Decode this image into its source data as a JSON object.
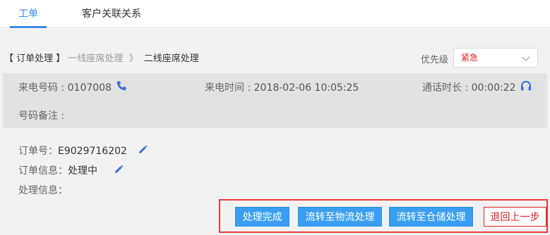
{
  "tabs": [
    {
      "label": "工单",
      "active": true
    },
    {
      "label": "客户关联关系",
      "active": false
    }
  ],
  "breadcrumb": {
    "current": "【 订单处理 】",
    "step1": "一线座席处理",
    "separator": "》",
    "step2": "二线座席处理"
  },
  "priority": {
    "label": "优先级",
    "value": "紧急"
  },
  "call_info": {
    "number_label": "来电号码 : ",
    "number_value": "0107008",
    "time_label": "来电时间 : ",
    "time_value": "2018-02-06 10:05:25",
    "duration_label": "通话时长 : ",
    "duration_value": "00:00:22",
    "note_label": "号码备注 :"
  },
  "order": {
    "id_label": "订单号：",
    "id_value": "E9029716202",
    "info_label": "订单信息：",
    "info_value": "处理中",
    "process_label": "处理信息："
  },
  "actions": {
    "complete": "处理完成",
    "to_logistics": "流转至物流处理",
    "to_warehouse": "流转至仓储处理",
    "go_back": "退回上一步"
  },
  "colors": {
    "accent": "#3a8ee6",
    "button": "#3a9ff2",
    "danger": "#e02020",
    "highlight_box": "#e83a3a"
  }
}
